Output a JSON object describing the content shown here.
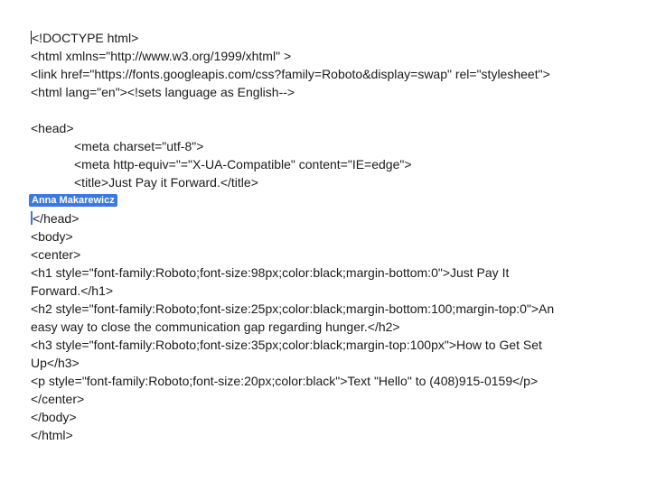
{
  "document": {
    "lines": [
      "<!DOCTYPE html>",
      "<html xmlns=\"http://www.w3.org/1999/xhtml\" >",
      "<link href=\"https://fonts.googleapis.com/css?family=Roboto&display=swap\" rel=\"stylesheet\">",
      "<html lang=\"en\"><!sets language as English-->",
      "",
      "<head>",
      "<meta charset=\"utf-8\">",
      "<meta http-equiv=\"=\"X-UA-Compatible\" content=\"IE=edge\">",
      "<title>Just Pay it Forward.</title>",
      "</head>",
      "<body>",
      "<center>",
      "<h1 style=\"font-family:Roboto;font-size:98px;color:black;margin-bottom:0\">Just Pay It",
      "Forward.</h1>",
      "<h2 style=\"font-family:Roboto;font-size:25px;color:black;margin-bottom:100;margin-top:0\">An",
      "easy way to close the communication gap regarding hunger.</h2>",
      "<h3 style=\"font-family:Roboto;font-size:35px;color:black;margin-top:100px\">How to Get Set",
      "Up</h3>",
      "<p style=\"font-family:Roboto;font-size:20px;color:black\">Text \"Hello\" to (408)915-0159</p>",
      "</center>",
      "</body>",
      "</html>"
    ],
    "collaborator": {
      "name": "Anna Makarewicz",
      "color": "#3b78e7"
    }
  }
}
